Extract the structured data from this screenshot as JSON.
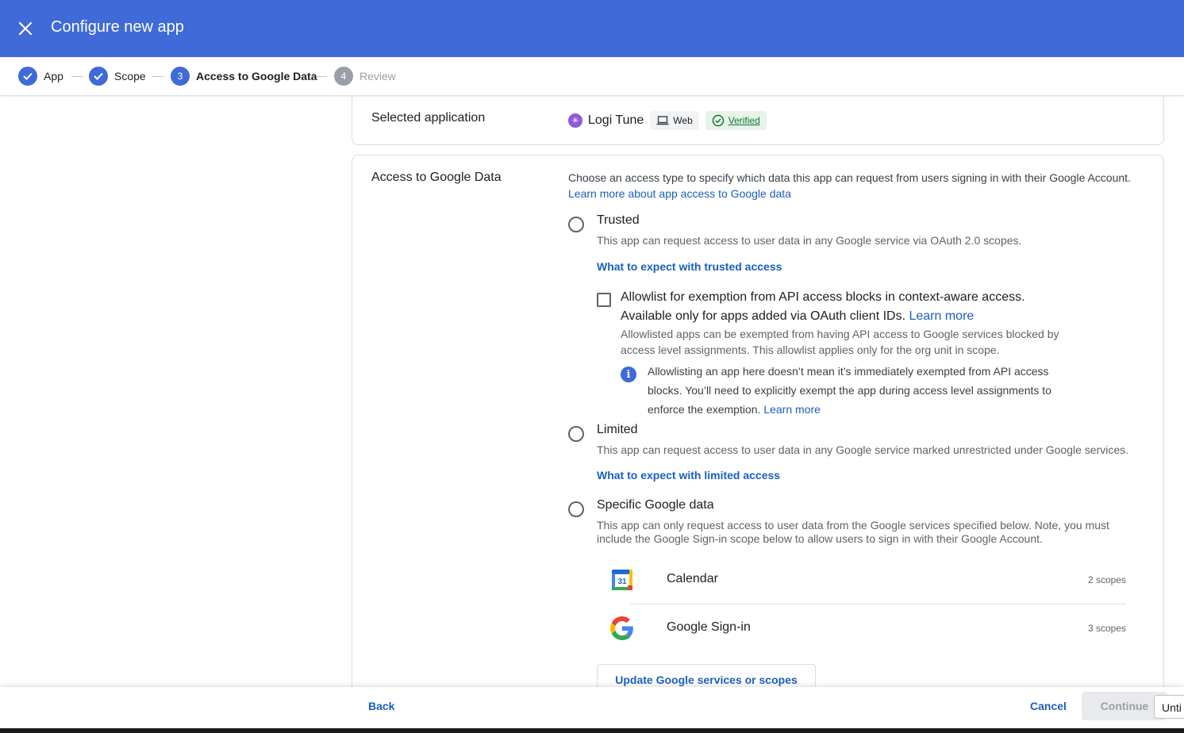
{
  "header": {
    "title": "Configure new app"
  },
  "stepper": {
    "steps": [
      {
        "label": "App",
        "marker": "",
        "state": "done"
      },
      {
        "label": "Scope",
        "marker": "",
        "state": "done"
      },
      {
        "label": "Access to Google Data",
        "marker": "3",
        "state": "active"
      },
      {
        "label": "Review",
        "marker": "4",
        "state": "pending"
      }
    ]
  },
  "selected_app": {
    "label": "Selected application",
    "app_name": "Logi Tune",
    "platform_chip": "Web",
    "verified_chip": "Verified"
  },
  "access": {
    "label": "Access to Google Data",
    "description": "Choose an access type to specify which data this app can request from users signing in with their Google Account.",
    "learn_more": "Learn more about app access to Google data",
    "options": {
      "trusted": {
        "title": "Trusted",
        "description": "This app can request access to user data in any Google service via OAuth 2.0 scopes.",
        "link": "What to expect with trusted access",
        "selected": false
      },
      "limited": {
        "title": "Limited",
        "description": "This app can request access to user data in any Google service marked unrestricted under Google services.",
        "link": "What to expect with limited access",
        "selected": false
      },
      "specific": {
        "title": "Specific Google data",
        "description": "This app can only request access to user data from the Google services specified below. Note, you must include the Google Sign-in scope below to allow users to sign in with their Google Account.",
        "selected": false
      }
    },
    "allowlist": {
      "checked": false,
      "title": "Allowlist for exemption from API access blocks in context-aware access.",
      "subtitle": "Available only for apps added via OAuth client IDs.",
      "learn_more": "Learn more",
      "description": "Allowlisted apps can be exempted from having API access to Google services blocked by access level assignments. This allowlist applies only for the org unit in scope.",
      "info": "Allowlisting an app here doesn’t mean it’s immediately exempted from API access blocks. You’ll need to explicitly exempt the app during access level assignments to enforce the exemption.",
      "info_learn_more": "Learn more"
    },
    "services": [
      {
        "name": "Calendar",
        "scopes": "2 scopes",
        "icon": "google-calendar-icon",
        "calendar_day": "31"
      },
      {
        "name": "Google Sign-in",
        "scopes": "3 scopes",
        "icon": "google-g-icon"
      }
    ],
    "update_button": "Update Google services or scopes"
  },
  "footer": {
    "back": "Back",
    "cancel": "Cancel",
    "continue": "Continue",
    "tab_peek": "Unti"
  },
  "colors": {
    "header_bg": "#3f6ad8",
    "link": "#1a5fbf",
    "verified_bg": "#e6f4ea",
    "verified_text": "#137333",
    "app_icon": "#8e5bd8"
  }
}
